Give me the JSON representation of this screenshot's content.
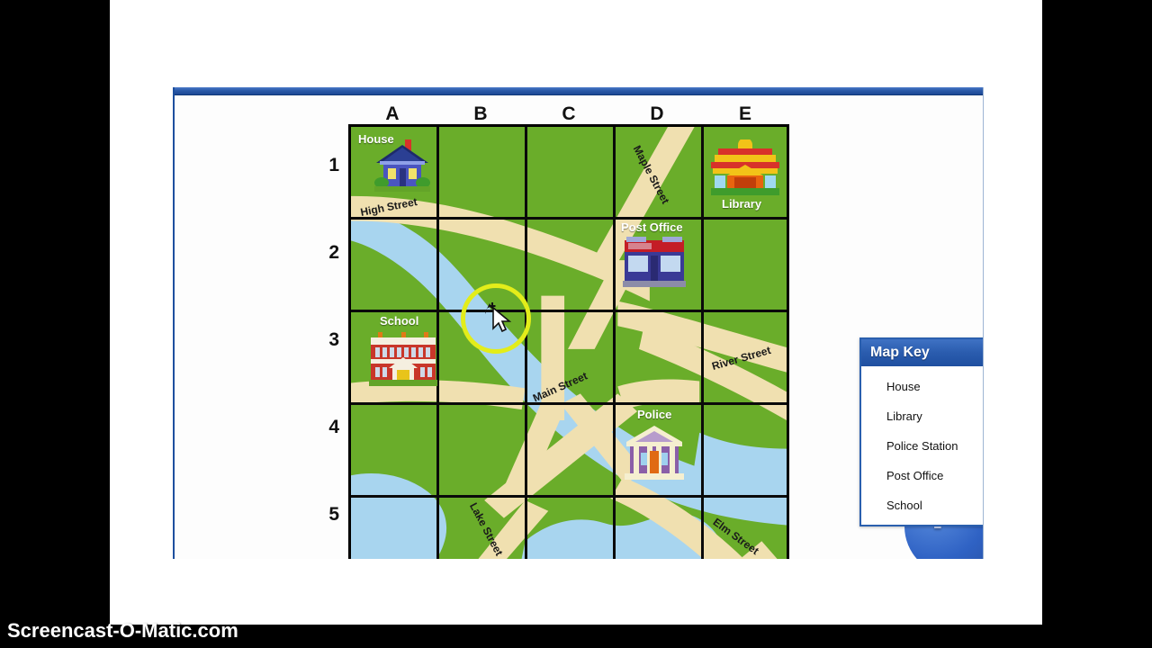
{
  "window": {
    "title": "",
    "watermark": "Screencast-O-Matic.com"
  },
  "grid": {
    "columns": [
      "A",
      "B",
      "C",
      "D",
      "E"
    ],
    "rows": [
      "1",
      "2",
      "3",
      "4",
      "5"
    ]
  },
  "map": {
    "places": [
      {
        "name": "House",
        "cell": "A1",
        "label": "House"
      },
      {
        "name": "Library",
        "cell": "E1",
        "label": "Library"
      },
      {
        "name": "Post Office",
        "cell": "D2",
        "label": "Post Office"
      },
      {
        "name": "School",
        "cell": "A3",
        "label": "School"
      },
      {
        "name": "Police",
        "cell": "D4",
        "label": "Police"
      }
    ],
    "streets": [
      {
        "name": "High Street",
        "label": "High Street"
      },
      {
        "name": "Maple Street",
        "label": "Maple Street"
      },
      {
        "name": "River Street",
        "label": "River Street"
      },
      {
        "name": "Main Street",
        "label": "Main Street"
      },
      {
        "name": "Lake Street",
        "label": "Lake Street"
      },
      {
        "name": "Elm Street",
        "label": "Elm Street"
      }
    ],
    "colors": {
      "grass": "#6aad2a",
      "water": "#a8d5ef",
      "road": "#f0e0b0",
      "gridline": "#0a0a0a"
    }
  },
  "map_key": {
    "title": "Map Key",
    "minimize_label": "",
    "items": [
      {
        "label": "House",
        "icon": "house-icon"
      },
      {
        "label": "Library",
        "icon": "library-icon"
      },
      {
        "label": "Police Station",
        "icon": "police-station-icon"
      },
      {
        "label": "Post Office",
        "icon": "post-office-icon"
      },
      {
        "label": "School",
        "icon": "school-icon"
      }
    ]
  },
  "help": {
    "label": "?"
  }
}
